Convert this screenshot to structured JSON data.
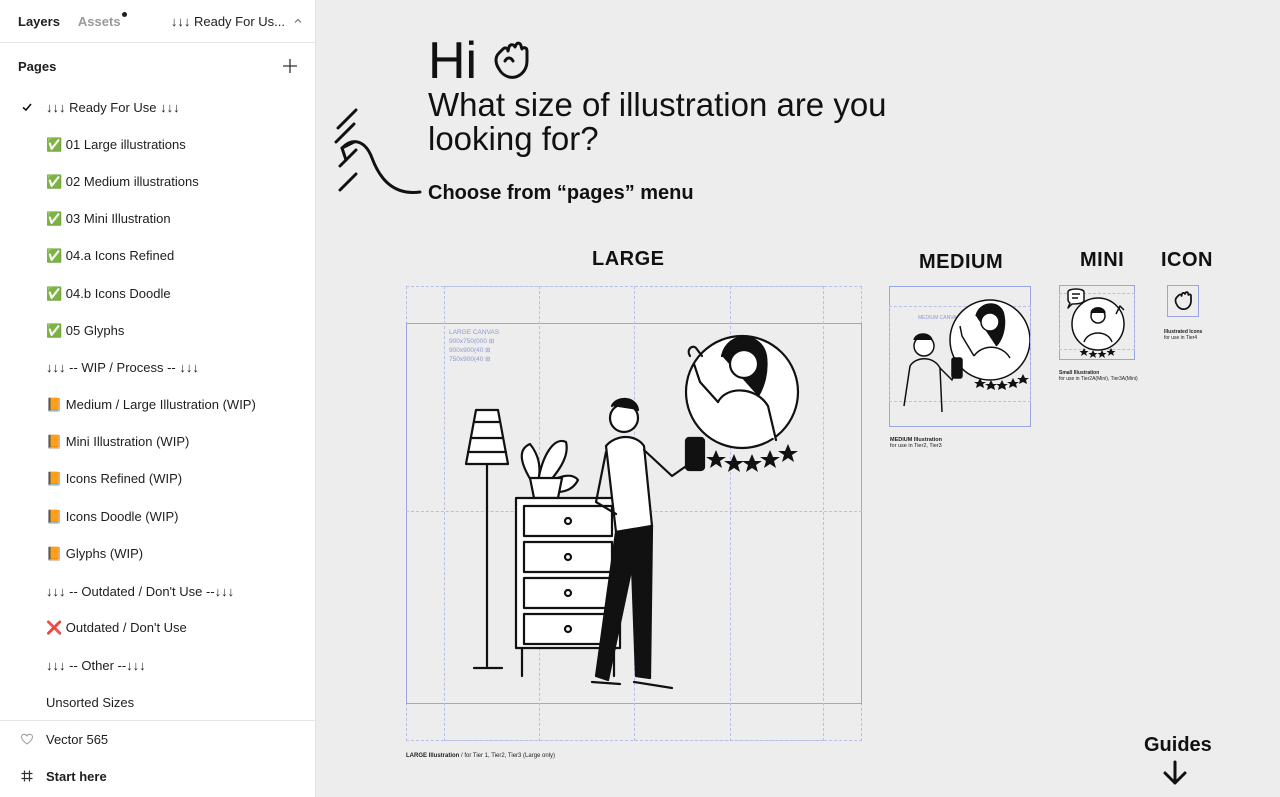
{
  "topbar": {
    "tab_layers": "Layers",
    "tab_assets": "Assets",
    "current_page": "↓↓↓ Ready For Us..."
  },
  "pages": {
    "title": "Pages",
    "items": [
      {
        "label": "↓↓↓ Ready For Use ↓↓↓",
        "active": true
      },
      {
        "label": "✅ 01 Large illustrations"
      },
      {
        "label": "✅ 02 Medium illustrations"
      },
      {
        "label": "✅ 03 Mini Illustration"
      },
      {
        "label": "✅ 04.a Icons Refined"
      },
      {
        "label": "✅ 04.b Icons Doodle"
      },
      {
        "label": "✅ 05 Glyphs"
      },
      {
        "label": "↓↓↓ -- WIP / Process -- ↓↓↓"
      },
      {
        "label": "📙 Medium / Large Illustration (WIP)"
      },
      {
        "label": "📙 Mini Illustration (WIP)"
      },
      {
        "label": "📙 Icons Refined (WIP)"
      },
      {
        "label": "📙 Icons Doodle (WIP)"
      },
      {
        "label": "📙 Glyphs (WIP)"
      },
      {
        "label": "↓↓↓ -- Outdated / Don't Use --↓↓↓"
      },
      {
        "label": "❌ Outdated / Don't Use"
      },
      {
        "label": "↓↓↓ -- Other --↓↓↓"
      },
      {
        "label": "Unsorted Sizes"
      }
    ]
  },
  "layers": [
    {
      "label": "Vector 565",
      "icon": "heart-outline-icon"
    },
    {
      "label": "Start here",
      "icon": "frame-hash-icon"
    }
  ],
  "canvas": {
    "greeting": "Hi",
    "headline": "What size of illustration are you looking for?",
    "subline": "Choose from “pages” menu",
    "sizes": {
      "large": "LARGE",
      "medium": "MEDIUM",
      "mini": "MINI",
      "icon": "ICON"
    },
    "large_canvas_note": {
      "title": "LARGE CANVAS",
      "sizes": [
        "900x750(000 ⊞",
        "900x900(40 ⊞",
        "750x900(40 ⊞"
      ]
    },
    "medium_canvas_note": "MEDIUM CANVAS",
    "captions": {
      "large_bold": "LARGE Illustration",
      "large_rest": " / for Tier 1, Tier2, Tier3 (Large only)",
      "medium_title": "MEDIUM Illustration",
      "medium_sub": "for use in Tier2, Tier3",
      "mini_title": "Small Illustration",
      "mini_sub": "for use in Tier2A(Mini), Tier3A(Mini)",
      "icon_title": "Illustrated Icons",
      "icon_sub": "for use in Tier4"
    },
    "guides": "Guides"
  },
  "colors": {
    "sidebar_bg": "#ffffff",
    "canvas_bg": "#ededed",
    "guide_blue": "#9aa6e0"
  }
}
